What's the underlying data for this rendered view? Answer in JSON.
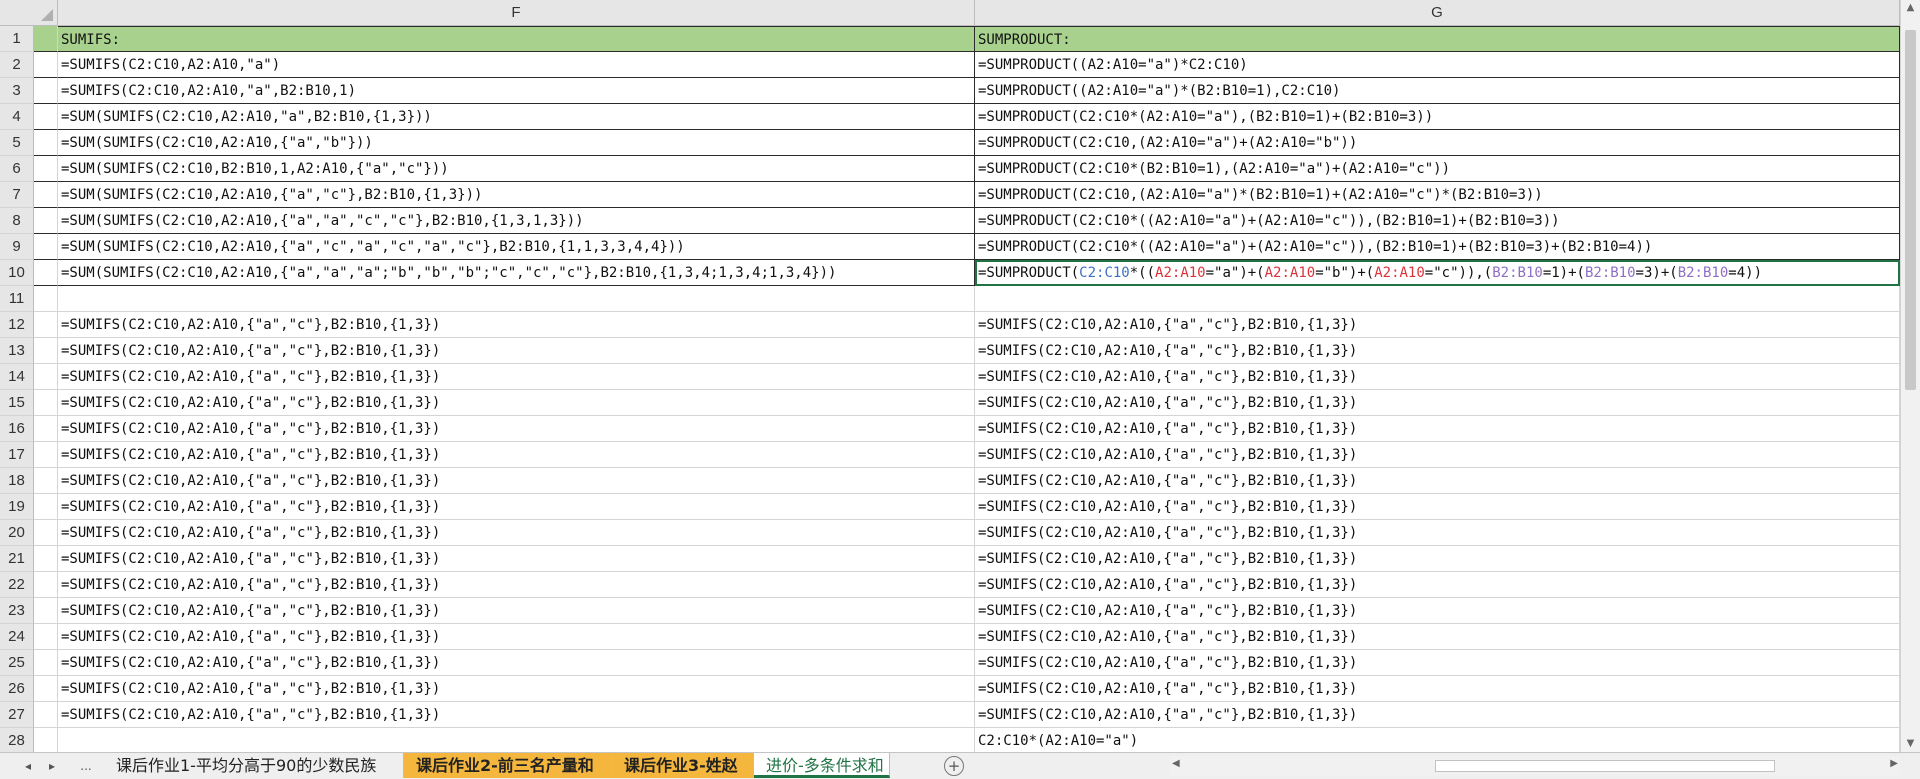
{
  "columns": {
    "F": "F",
    "G": "G"
  },
  "rows": [
    {
      "n": "1",
      "F": "SUMIFS:",
      "G": "SUMPRODUCT:"
    },
    {
      "n": "2",
      "F": "=SUMIFS(C2:C10,A2:A10,\"a\")",
      "G": "=SUMPRODUCT((A2:A10=\"a\")*C2:C10)"
    },
    {
      "n": "3",
      "F": "=SUMIFS(C2:C10,A2:A10,\"a\",B2:B10,1)",
      "G": "=SUMPRODUCT((A2:A10=\"a\")*(B2:B10=1),C2:C10)"
    },
    {
      "n": "4",
      "F": "=SUM(SUMIFS(C2:C10,A2:A10,\"a\",B2:B10,{1,3}))",
      "G": "=SUMPRODUCT(C2:C10*(A2:A10=\"a\"),(B2:B10=1)+(B2:B10=3))"
    },
    {
      "n": "5",
      "F": "=SUM(SUMIFS(C2:C10,A2:A10,{\"a\",\"b\"}))",
      "G": "=SUMPRODUCT(C2:C10,(A2:A10=\"a\")+(A2:A10=\"b\"))"
    },
    {
      "n": "6",
      "F": "=SUM(SUMIFS(C2:C10,B2:B10,1,A2:A10,{\"a\",\"c\"}))",
      "G": "=SUMPRODUCT(C2:C10*(B2:B10=1),(A2:A10=\"a\")+(A2:A10=\"c\"))"
    },
    {
      "n": "7",
      "F": "=SUM(SUMIFS(C2:C10,A2:A10,{\"a\",\"c\"},B2:B10,{1,3}))",
      "G": "=SUMPRODUCT(C2:C10,(A2:A10=\"a\")*(B2:B10=1)+(A2:A10=\"c\")*(B2:B10=3))"
    },
    {
      "n": "8",
      "F": "=SUM(SUMIFS(C2:C10,A2:A10,{\"a\",\"a\",\"c\",\"c\"},B2:B10,{1,3,1,3}))",
      "G": "=SUMPRODUCT(C2:C10*((A2:A10=\"a\")+(A2:A10=\"c\")),(B2:B10=1)+(B2:B10=3))"
    },
    {
      "n": "9",
      "F": "=SUM(SUMIFS(C2:C10,A2:A10,{\"a\",\"c\",\"a\",\"c\",\"a\",\"c\"},B2:B10,{1,1,3,3,4,4}))",
      "G": "=SUMPRODUCT(C2:C10*((A2:A10=\"a\")+(A2:A10=\"c\")),(B2:B10=1)+(B2:B10=3)+(B2:B10=4))"
    },
    {
      "n": "10",
      "F": "=SUM(SUMIFS(C2:C10,A2:A10,{\"a\",\"a\",\"a\";\"b\",\"b\",\"b\";\"c\",\"c\",\"c\"},B2:B10,{1,3,4;1,3,4;1,3,4}))",
      "G": "=SUMPRODUCT(C2:C10*((A2:A10=\"a\")+(A2:A10=\"b\")+(A2:A10=\"c\")),(B2:B10=1)+(B2:B10=3)+(B2:B10=4))"
    },
    {
      "n": "11",
      "F": "",
      "G": ""
    },
    {
      "n": "12",
      "F": "=SUMIFS(C2:C10,A2:A10,{\"a\",\"c\"},B2:B10,{1,3})",
      "G": "=SUMIFS(C2:C10,A2:A10,{\"a\",\"c\"},B2:B10,{1,3})"
    },
    {
      "n": "13",
      "F": "=SUMIFS(C2:C10,A2:A10,{\"a\",\"c\"},B2:B10,{1,3})",
      "G": "=SUMIFS(C2:C10,A2:A10,{\"a\",\"c\"},B2:B10,{1,3})"
    },
    {
      "n": "14",
      "F": "=SUMIFS(C2:C10,A2:A10,{\"a\",\"c\"},B2:B10,{1,3})",
      "G": "=SUMIFS(C2:C10,A2:A10,{\"a\",\"c\"},B2:B10,{1,3})"
    },
    {
      "n": "15",
      "F": "=SUMIFS(C2:C10,A2:A10,{\"a\",\"c\"},B2:B10,{1,3})",
      "G": "=SUMIFS(C2:C10,A2:A10,{\"a\",\"c\"},B2:B10,{1,3})"
    },
    {
      "n": "16",
      "F": "=SUMIFS(C2:C10,A2:A10,{\"a\",\"c\"},B2:B10,{1,3})",
      "G": "=SUMIFS(C2:C10,A2:A10,{\"a\",\"c\"},B2:B10,{1,3})"
    },
    {
      "n": "17",
      "F": "=SUMIFS(C2:C10,A2:A10,{\"a\",\"c\"},B2:B10,{1,3})",
      "G": "=SUMIFS(C2:C10,A2:A10,{\"a\",\"c\"},B2:B10,{1,3})"
    },
    {
      "n": "18",
      "F": "=SUMIFS(C2:C10,A2:A10,{\"a\",\"c\"},B2:B10,{1,3})",
      "G": "=SUMIFS(C2:C10,A2:A10,{\"a\",\"c\"},B2:B10,{1,3})"
    },
    {
      "n": "19",
      "F": "=SUMIFS(C2:C10,A2:A10,{\"a\",\"c\"},B2:B10,{1,3})",
      "G": "=SUMIFS(C2:C10,A2:A10,{\"a\",\"c\"},B2:B10,{1,3})"
    },
    {
      "n": "20",
      "F": "=SUMIFS(C2:C10,A2:A10,{\"a\",\"c\"},B2:B10,{1,3})",
      "G": "=SUMIFS(C2:C10,A2:A10,{\"a\",\"c\"},B2:B10,{1,3})"
    },
    {
      "n": "21",
      "F": "=SUMIFS(C2:C10,A2:A10,{\"a\",\"c\"},B2:B10,{1,3})",
      "G": "=SUMIFS(C2:C10,A2:A10,{\"a\",\"c\"},B2:B10,{1,3})"
    },
    {
      "n": "22",
      "F": "=SUMIFS(C2:C10,A2:A10,{\"a\",\"c\"},B2:B10,{1,3})",
      "G": "=SUMIFS(C2:C10,A2:A10,{\"a\",\"c\"},B2:B10,{1,3})"
    },
    {
      "n": "23",
      "F": "=SUMIFS(C2:C10,A2:A10,{\"a\",\"c\"},B2:B10,{1,3})",
      "G": "=SUMIFS(C2:C10,A2:A10,{\"a\",\"c\"},B2:B10,{1,3})"
    },
    {
      "n": "24",
      "F": "=SUMIFS(C2:C10,A2:A10,{\"a\",\"c\"},B2:B10,{1,3})",
      "G": "=SUMIFS(C2:C10,A2:A10,{\"a\",\"c\"},B2:B10,{1,3})"
    },
    {
      "n": "25",
      "F": "=SUMIFS(C2:C10,A2:A10,{\"a\",\"c\"},B2:B10,{1,3})",
      "G": "=SUMIFS(C2:C10,A2:A10,{\"a\",\"c\"},B2:B10,{1,3})"
    },
    {
      "n": "26",
      "F": "=SUMIFS(C2:C10,A2:A10,{\"a\",\"c\"},B2:B10,{1,3})",
      "G": "=SUMIFS(C2:C10,A2:A10,{\"a\",\"c\"},B2:B10,{1,3})"
    },
    {
      "n": "27",
      "F": "=SUMIFS(C2:C10,A2:A10,{\"a\",\"c\"},B2:B10,{1,3})",
      "G": "=SUMIFS(C2:C10,A2:A10,{\"a\",\"c\"},B2:B10,{1,3})"
    },
    {
      "n": "28",
      "F": "",
      "G": "C2:C10*(A2:A10=\"a\")"
    }
  ],
  "active_cell": "G10",
  "reference_colors": {
    "C2:C10": "#3f6fc5",
    "A2:A10": "#d9333a",
    "B2:B10": "#8e6fc4"
  },
  "header_fill_color": "#a9d18e",
  "tabs": {
    "nav_prev": "◂",
    "nav_next": "▸",
    "nav_more": "...",
    "items": [
      {
        "label": "课后作业1-平均分高于90的少数民族",
        "style": "normal"
      },
      {
        "label": "课后作业2-前三名产量和",
        "style": "orange"
      },
      {
        "label": "课后作业3-姓赵",
        "style": "orange"
      },
      {
        "label": "进价-多条件求和",
        "style": "active"
      }
    ],
    "add_sheet": "+"
  },
  "icons": [
    "scroll-up-icon",
    "scroll-down-icon",
    "scroll-left-icon",
    "scroll-right-icon",
    "add-sheet-icon",
    "select-all-icon"
  ]
}
